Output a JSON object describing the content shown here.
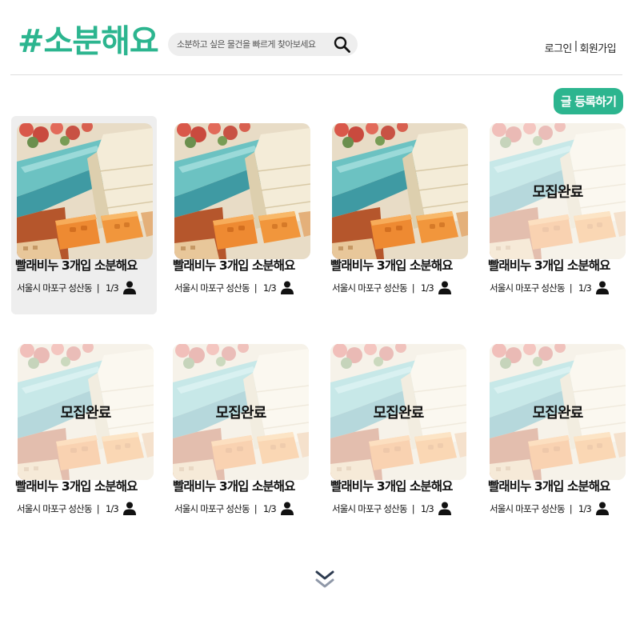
{
  "header": {
    "logo": "#소분해요",
    "search_placeholder": "소분하고 싶은 물건을 빠르게 찾아보세요",
    "login": "로그인",
    "auth_separator": "|",
    "signup": "회원가입"
  },
  "toolbar": {
    "post_label": "글 등록하기"
  },
  "colors": {
    "brand": "#2cb58f",
    "selected_card_bg": "#eeeeee"
  },
  "posts": [
    {
      "title": "빨래비누 3개입 소분해요",
      "location": "서울시 마포구 성산동",
      "participants": "1/3",
      "status": ""
    },
    {
      "title": "빨래비누 3개입 소분해요",
      "location": "서울시 마포구 성산동",
      "participants": "1/3",
      "status": ""
    },
    {
      "title": "빨래비누 3개입 소분해요",
      "location": "서울시 마포구 성산동",
      "participants": "1/3",
      "status": ""
    },
    {
      "title": "빨래비누 3개입 소분해요",
      "location": "서울시 마포구 성산동",
      "participants": "1/3",
      "status": "모집완료"
    },
    {
      "title": "빨래비누 3개입 소분해요",
      "location": "서울시 마포구 성산동",
      "participants": "1/3",
      "status": "모집완료"
    },
    {
      "title": "빨래비누 3개입 소분해요",
      "location": "서울시 마포구 성산동",
      "participants": "1/3",
      "status": "모집완료"
    },
    {
      "title": "빨래비누 3개입 소분해요",
      "location": "서울시 마포구 성산동",
      "participants": "1/3",
      "status": "모집완료"
    },
    {
      "title": "빨래비누 3개입 소분해요",
      "location": "서울시 마포구 성산동",
      "participants": "1/3",
      "status": "모집완료"
    }
  ],
  "icons": {
    "search": "search-icon",
    "person": "person-icon",
    "more": "chevron-double-down-icon"
  }
}
